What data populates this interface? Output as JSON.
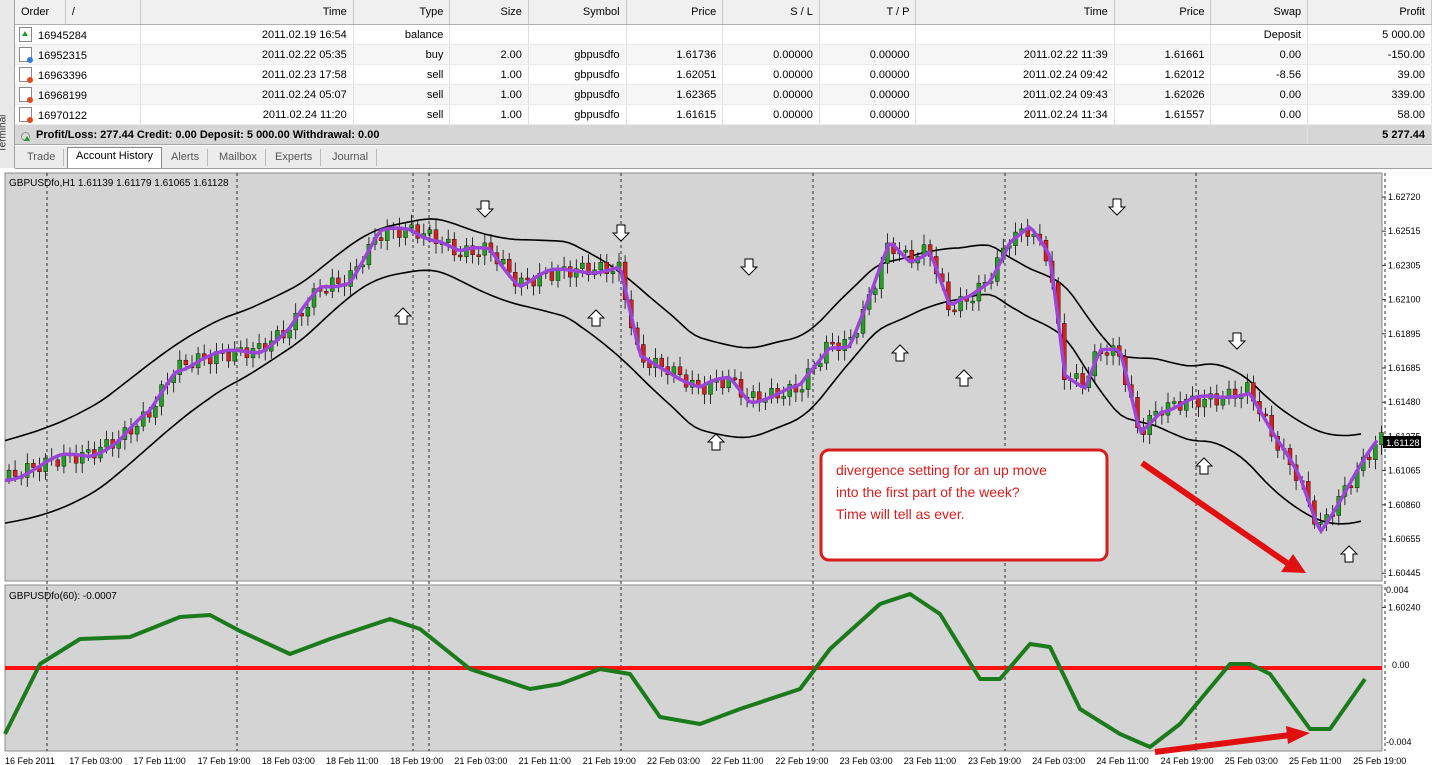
{
  "terminal_label": "Terminal",
  "columns": [
    "Order",
    "/",
    "Time",
    "Type",
    "Size",
    "Symbol",
    "Price",
    "S / L",
    "T / P",
    "Time",
    "Price",
    "Swap",
    "Profit"
  ],
  "rows": [
    {
      "icon": "balance",
      "order": "16945284",
      "time": "2011.02.19 16:54",
      "type": "balance",
      "size": "",
      "symbol": "",
      "price": "",
      "sl": "",
      "tp": "",
      "close_time": "",
      "close_price": "",
      "swap": "Deposit",
      "profit": "5 000.00"
    },
    {
      "icon": "buy",
      "order": "16952315",
      "time": "2011.02.22 05:35",
      "type": "buy",
      "size": "2.00",
      "symbol": "gbpusdfo",
      "price": "1.61736",
      "sl": "0.00000",
      "tp": "0.00000",
      "close_time": "2011.02.22 11:39",
      "close_price": "1.61661",
      "swap": "0.00",
      "profit": "-150.00"
    },
    {
      "icon": "sell",
      "order": "16963396",
      "time": "2011.02.23 17:58",
      "type": "sell",
      "size": "1.00",
      "symbol": "gbpusdfo",
      "price": "1.62051",
      "sl": "0.00000",
      "tp": "0.00000",
      "close_time": "2011.02.24 09:42",
      "close_price": "1.62012",
      "swap": "-8.56",
      "profit": "39.00"
    },
    {
      "icon": "sell",
      "order": "16968199",
      "time": "2011.02.24 05:07",
      "type": "sell",
      "size": "1.00",
      "symbol": "gbpusdfo",
      "price": "1.62365",
      "sl": "0.00000",
      "tp": "0.00000",
      "close_time": "2011.02.24 09:43",
      "close_price": "1.62026",
      "swap": "0.00",
      "profit": "339.00"
    },
    {
      "icon": "sell",
      "order": "16970122",
      "time": "2011.02.24 11:20",
      "type": "sell",
      "size": "1.00",
      "symbol": "gbpusdfo",
      "price": "1.61615",
      "sl": "0.00000",
      "tp": "0.00000",
      "close_time": "2011.02.24 11:34",
      "close_price": "1.61557",
      "swap": "0.00",
      "profit": "58.00"
    }
  ],
  "summary": {
    "text": "Profit/Loss: 277.44   Credit: 0.00   Deposit: 5 000.00   Withdrawal: 0.00",
    "total": "5 277.44"
  },
  "tabs": [
    "Trade",
    "Account History",
    "Alerts",
    "Mailbox",
    "Experts",
    "Journal"
  ],
  "active_tab": "Account History",
  "chart": {
    "header": "GBPUSDfo,H1  1.61139 1.61179 1.61065 1.61128",
    "current_price": "1.61128",
    "price_ticks": [
      "1.62720",
      "1.62515",
      "1.62305",
      "1.62100",
      "1.61895",
      "1.61685",
      "1.61480",
      "1.61275",
      "1.61065",
      "1.60860",
      "1.60655",
      "1.60445",
      "1.60240"
    ],
    "date_ticks": [
      "16 Feb 2011",
      "17 Feb 03:00",
      "17 Feb 11:00",
      "17 Feb 19:00",
      "18 Feb 03:00",
      "18 Feb 11:00",
      "18 Feb 19:00",
      "21 Feb 03:00",
      "21 Feb 11:00",
      "21 Feb 19:00",
      "22 Feb 03:00",
      "22 Feb 11:00",
      "22 Feb 19:00",
      "23 Feb 03:00",
      "23 Feb 11:00",
      "23 Feb 19:00",
      "24 Feb 03:00",
      "24 Feb 11:00",
      "24 Feb 19:00",
      "25 Feb 03:00",
      "25 Feb 11:00",
      "25 Feb 19:00"
    ],
    "annotation": [
      "divergence setting  for an up move",
      "into the first part of the week?",
      "Time will tell as ever."
    ],
    "indicator_header": "GBPUSDfo(60):  -0.0007",
    "indicator_ticks": [
      "0.004",
      "0.00",
      "-0.004"
    ],
    "colors": {
      "bull": "#22a022",
      "bear": "#d42020",
      "ma": "#9b45d8",
      "osc": "#1b7a1b",
      "zero": "#ff1010",
      "arrow": "#e01010",
      "bg": "#d4d4d4"
    }
  }
}
